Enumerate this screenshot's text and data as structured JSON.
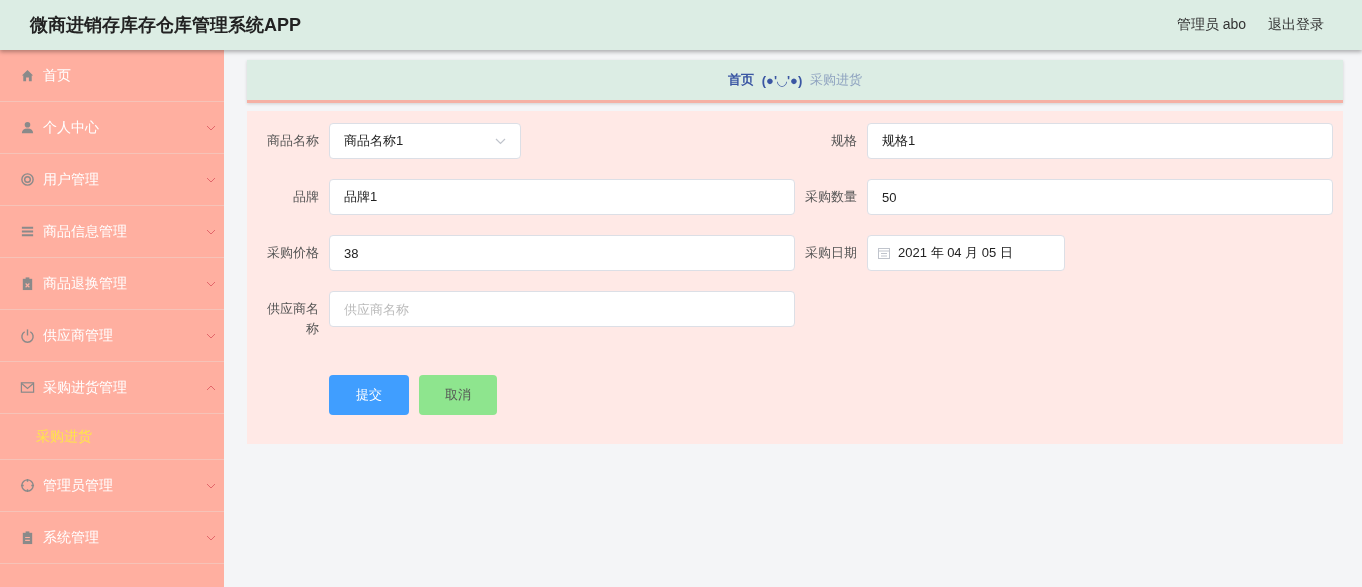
{
  "header": {
    "title": "微商进销存库存仓库管理系统APP",
    "user": "管理员 abo",
    "logout": "退出登录"
  },
  "sidebar": {
    "items": [
      {
        "label": "首页",
        "kind": "link"
      },
      {
        "label": "个人中心",
        "kind": "submenu",
        "expanded": false
      },
      {
        "label": "用户管理",
        "kind": "submenu",
        "expanded": false
      },
      {
        "label": "商品信息管理",
        "kind": "submenu",
        "expanded": false
      },
      {
        "label": "商品退换管理",
        "kind": "submenu",
        "expanded": false
      },
      {
        "label": "供应商管理",
        "kind": "submenu",
        "expanded": false
      },
      {
        "label": "采购进货管理",
        "kind": "submenu",
        "expanded": true,
        "children": [
          {
            "label": "采购进货",
            "selected": true
          }
        ]
      },
      {
        "label": "管理员管理",
        "kind": "submenu",
        "expanded": false
      },
      {
        "label": "系统管理",
        "kind": "submenu",
        "expanded": false
      }
    ]
  },
  "breadcrumb": {
    "home": "首页",
    "separator": "(●'◡'●)",
    "current": "采购进货"
  },
  "form": {
    "fields": [
      {
        "label": "商品名称",
        "kind": "select",
        "value": "商品名称1"
      },
      {
        "label": "规格",
        "kind": "text",
        "value": "规格1"
      },
      {
        "label": "品牌",
        "kind": "text",
        "value": "品牌1"
      },
      {
        "label": "采购数量",
        "kind": "text",
        "value": "50"
      },
      {
        "label": "采购价格",
        "kind": "text",
        "value": "38"
      },
      {
        "label": "采购日期",
        "kind": "date",
        "value": "2021 年 04 月 05 日"
      },
      {
        "label": "供应商名称",
        "kind": "text",
        "placeholder": "供应商名称"
      }
    ],
    "buttons": [
      {
        "label": "提交",
        "kind": "primary"
      },
      {
        "label": "取消",
        "kind": "cancel"
      }
    ]
  }
}
